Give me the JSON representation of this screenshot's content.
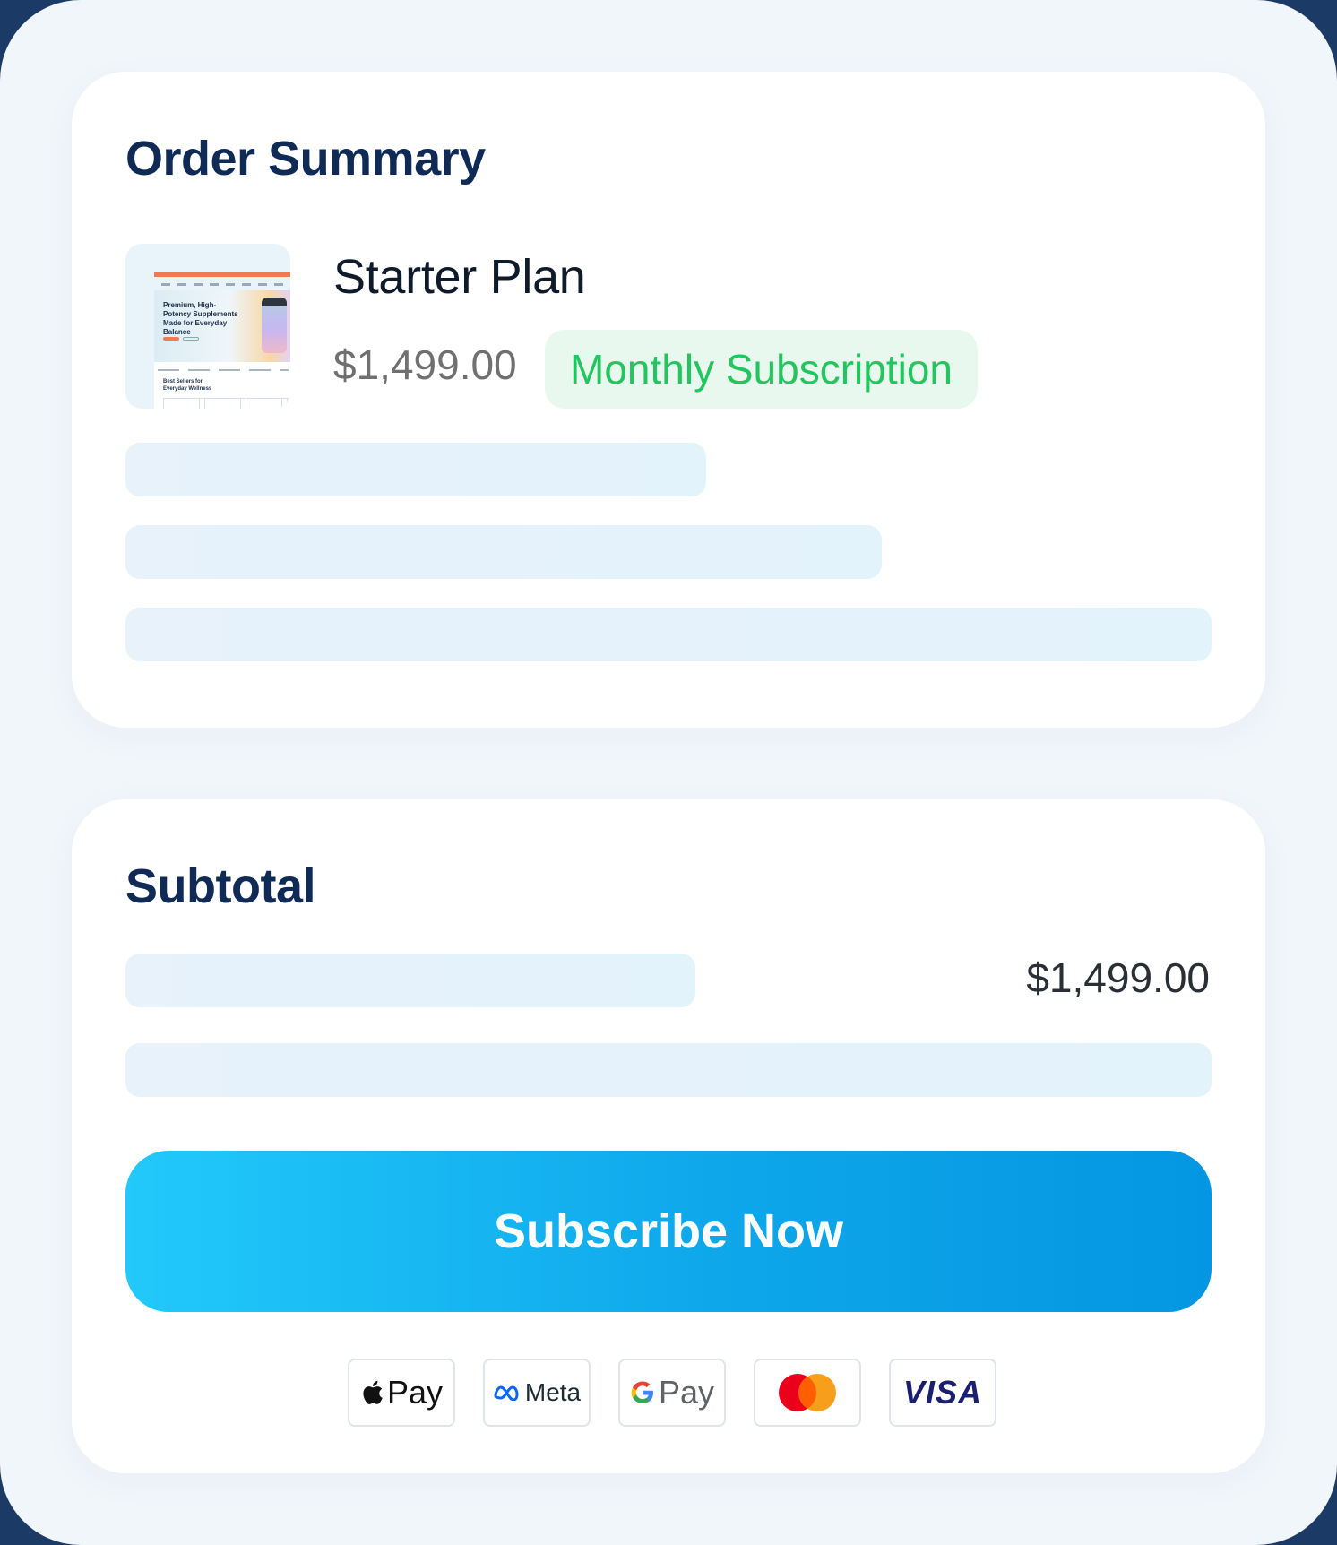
{
  "order_summary": {
    "title": "Order Summary",
    "product": {
      "name": "Starter Plan",
      "price": "$1,499.00",
      "billing": "Monthly Subscription",
      "thumbnail_headline": "Premium, High-Potency Supplements Made for Everyday Balance",
      "thumbnail_section": "Best Sellers for Everyday Wellness"
    }
  },
  "subtotal": {
    "title": "Subtotal",
    "amount": "$1,499.00"
  },
  "cta": {
    "label": "Subscribe Now"
  },
  "payment_methods": [
    {
      "name": "Apple Pay",
      "label": "Pay",
      "icon": "apple-icon"
    },
    {
      "name": "Meta",
      "label": "Meta",
      "icon": "meta-infinity-icon"
    },
    {
      "name": "Google Pay",
      "label": "Pay",
      "icon": "google-g-icon"
    },
    {
      "name": "Mastercard",
      "label": "",
      "icon": "mastercard-icon"
    },
    {
      "name": "Visa",
      "label": "VISA",
      "icon": "visa-icon"
    }
  ],
  "colors": {
    "heading": "#0f2a55",
    "badge_text": "#22c55e",
    "badge_bg": "#e9f8ee",
    "button_start": "#22c9fb",
    "button_end": "#0496e2"
  }
}
